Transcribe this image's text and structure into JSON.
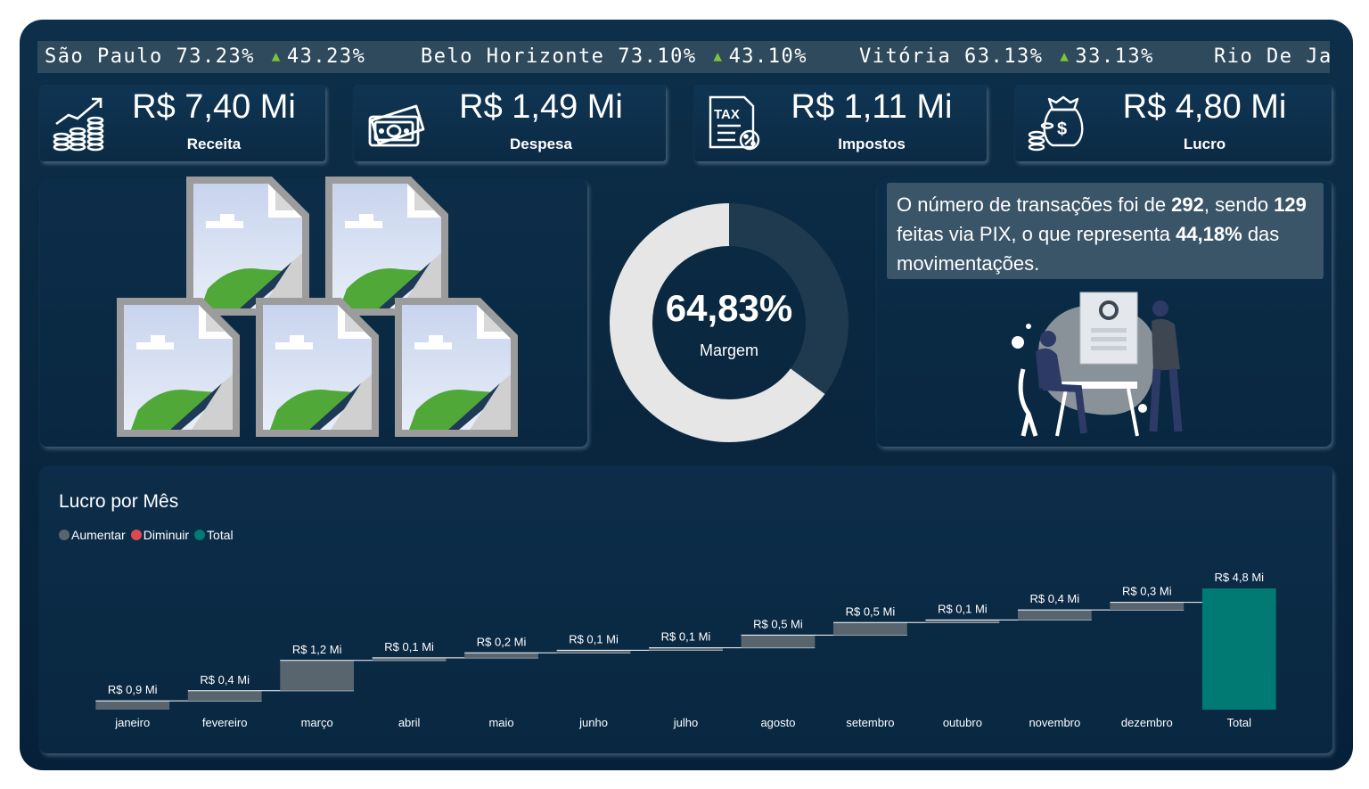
{
  "ticker": [
    {
      "city": "São Paulo",
      "value": "73.23%",
      "change": "43.23%"
    },
    {
      "city": "Belo Horizonte",
      "value": "73.10%",
      "change": "43.10%"
    },
    {
      "city": "Vitória",
      "value": "63.13%",
      "change": "33.13%"
    },
    {
      "city": "Rio De Jai",
      "value": "",
      "change": ""
    }
  ],
  "kpis": [
    {
      "value": "R$ 7,40 Mi",
      "label": "Receita",
      "icon": "coins-growth-icon"
    },
    {
      "value": "R$ 1,49 Mi",
      "label": "Despesa",
      "icon": "banknote-icon"
    },
    {
      "value": "R$ 1,11 Mi",
      "label": "Impostos",
      "icon": "tax-document-icon"
    },
    {
      "value": "R$ 4,80 Mi",
      "label": "Lucro",
      "icon": "money-bag-icon"
    }
  ],
  "margin": {
    "value": "64,83%",
    "label": "Margem",
    "percent": 64.83
  },
  "info": {
    "t1": "O número de transações foi de ",
    "n1": "292",
    "t2": ", sendo ",
    "n2": "129",
    "t3": " feitas via PIX, o que representa ",
    "n3": "44,18%",
    "t4": " das movimentações."
  },
  "colors": {
    "increase": "#58656f",
    "decrease": "#e0484f",
    "total": "#007a72",
    "donut_fill": "#e6e6e6",
    "donut_track": "#1f3a4f"
  },
  "chart_data": {
    "type": "waterfall",
    "title": "Lucro por Mês",
    "legend": [
      "Aumentar",
      "Diminuir",
      "Total"
    ],
    "legend_position": "top-left",
    "categories": [
      "janeiro",
      "fevereiro",
      "março",
      "abril",
      "maio",
      "junho",
      "julho",
      "agosto",
      "setembro",
      "outubro",
      "novembro",
      "dezembro",
      "Total"
    ],
    "values": [
      0.35,
      0.4,
      1.2,
      0.1,
      0.2,
      0.1,
      0.1,
      0.5,
      0.5,
      0.1,
      0.4,
      0.3,
      4.8
    ],
    "data_labels": [
      "R$ 0,9 Mi",
      "R$ 0,4 Mi",
      "R$ 1,2 Mi",
      "R$ 0,1 Mi",
      "R$ 0,2 Mi",
      "R$ 0,1 Mi",
      "R$ 0,1 Mi",
      "R$ 0,5 Mi",
      "R$ 0,5 Mi",
      "R$ 0,1 Mi",
      "R$ 0,4 Mi",
      "R$ 0,3 Mi",
      "R$ 4,8 Mi"
    ],
    "kinds": [
      "increase",
      "increase",
      "increase",
      "increase",
      "increase",
      "increase",
      "increase",
      "increase",
      "increase",
      "increase",
      "increase",
      "increase",
      "total"
    ],
    "ylim": [
      0,
      5.2
    ],
    "grid": false
  }
}
